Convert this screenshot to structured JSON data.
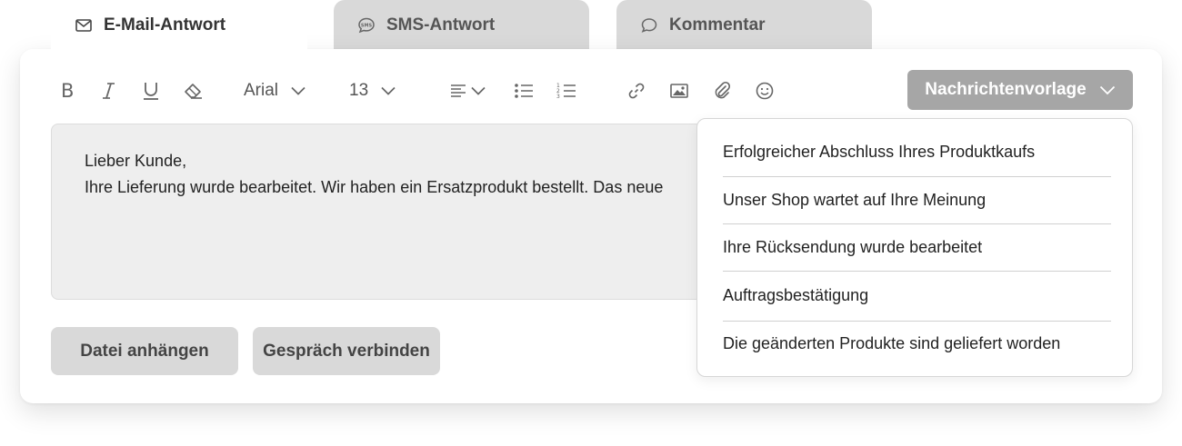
{
  "tabs": [
    {
      "label": "E-Mail-Antwort",
      "icon": "mail-icon",
      "active": true
    },
    {
      "label": "SMS-Antwort",
      "icon": "sms-bubble-icon",
      "active": false
    },
    {
      "label": "Kommentar",
      "icon": "comment-bubble-icon",
      "active": false
    }
  ],
  "toolbar": {
    "font_family": "Arial",
    "font_size": "13",
    "template_button": "Nachrichtenvorlage"
  },
  "editor": {
    "lines": [
      "Lieber Kunde,",
      "Ihre Lieferung wurde bearbeitet. Wir haben ein Ersatzprodukt bestellt. Das neue"
    ]
  },
  "buttons": {
    "attach_file": "Datei anhängen",
    "connect_call": "Gespräch verbinden"
  },
  "template_dropdown": {
    "items": [
      "Erfolgreicher Abschluss Ihres Produktkaufs",
      "Unser Shop wartet auf Ihre Meinung",
      "Ihre Rücksendung wurde bearbeitet",
      "Auftragsbestätigung",
      "Die geänderten Produkte sind geliefert worden"
    ]
  },
  "colors": {
    "tab_inactive": "#d9d9d9",
    "template_button": "#a6a6a6",
    "editor_bg": "#eeeeee"
  }
}
